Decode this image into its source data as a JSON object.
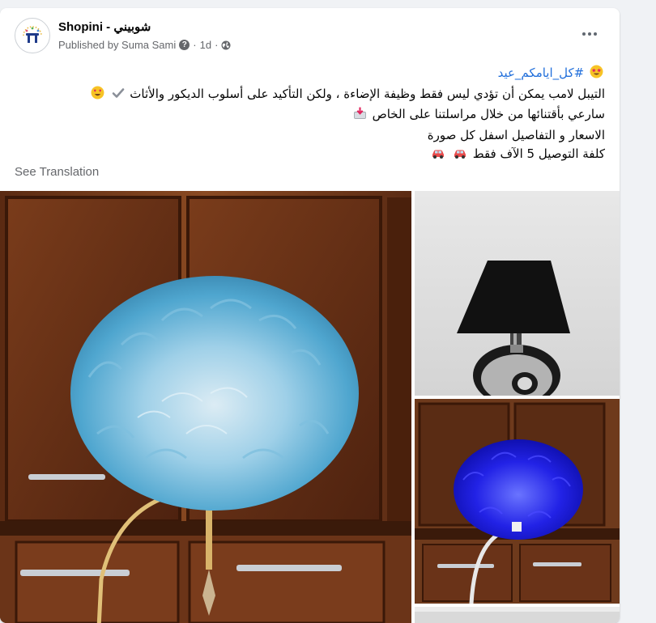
{
  "post": {
    "page_name": "Shopini - شوبيني",
    "published_by": "Published by Suma Sami",
    "help_icon": "question-circle-icon",
    "separator": "·",
    "time": "1d",
    "audience_icon": "globe-icon",
    "more_icon": "more-horizontal-icon",
    "hashtag": "#كل_ايامكم_عيد",
    "lines": [
      "التيبل لامب يمكن أن تؤدي ليس فقط وظيفة الإضاءة ، ولكن التأكيد على أسلوب الديكور والأثاث",
      "سارعي بأقتنائها من خلال مراسلتنا على الخاص",
      "الاسعار و التفاصيل اسفل كل صورة",
      "كلفة التوصيل 5 الآف فقط"
    ],
    "see_translation": "See Translation",
    "photos": [
      {
        "subject": "blue-feather-lamp-photo"
      },
      {
        "subject": "black-shade-lamp-photo"
      },
      {
        "subject": "blue-illuminated-feather-lamp-photo"
      },
      {
        "subject": "additional-photo"
      }
    ]
  },
  "colors": {
    "link": "#216fdb",
    "secondary_text": "#65676b",
    "background": "#f0f2f5",
    "card": "#ffffff"
  }
}
